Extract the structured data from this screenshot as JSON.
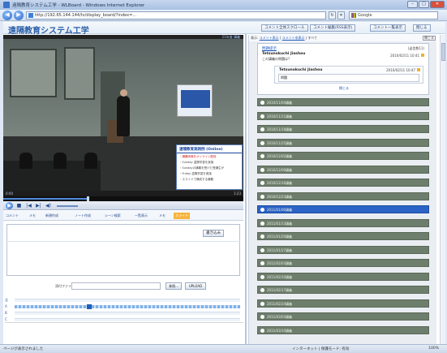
{
  "browser": {
    "window_title": "遠隔教育システム工学 - WLBoard - Windows Internet Explorer",
    "url": "http://192.65.144.144/tv/display_board/?index=…",
    "search_placeholder": "Google",
    "nav_back": "◀",
    "nav_forward": "▶",
    "refresh": "↻",
    "stop": "✕",
    "status_left": "ページが表示されました",
    "status_zone": "インターネット | 保護モード: 有効",
    "status_zoom": "100%"
  },
  "app": {
    "title": "遠隔教育システム工学",
    "buttons": [
      "コメント全体スクロール",
      "コメント編集(RSS表示)",
      "コメント一覧表示",
      "閉じる"
    ]
  },
  "player": {
    "top_label": "21年度 講義",
    "time_current": "0:00",
    "time_total": "1:23",
    "progress_fraction": 0.35,
    "controls": [
      "▶",
      "■",
      "|◀",
      "▶|",
      "◀)"
    ],
    "toolbar_items": [
      "コメント",
      "メモ",
      "新規作成",
      "ノート作成",
      "シーン検索",
      "一覧表示",
      "メモ",
      "スライド"
    ],
    "slide": {
      "title": "遠隔教育実践例 (Online)",
      "lines": [
        "・講義映像をオンライン配信",
        "・Sunday 遠隔学習を実施",
        "・Sundayの講義を受けた受講生が",
        "・Friday 遠隔学習を実施",
        "・スライドで構成する講義"
      ]
    }
  },
  "editor": {
    "post_label": "書き込み",
    "file_label": "添付ファイル",
    "browse_label": "参照...",
    "upload_label": "UPLOAD"
  },
  "comments": {
    "header_prefix": "表示:",
    "links": [
      "コメント表示",
      "コメント非表示"
    ],
    "header_suffix": "| すべて",
    "close_btn": "閉じる",
    "thread_title": "問題提示",
    "thread_count": "(返信数11)",
    "author": "Tetsunokuchi Jiashou",
    "body": "この講義の問題は?",
    "date": "2010/02/11 10:41",
    "reply_author": "Tetsunokuchi Jiashou",
    "reply_date": "2010/02/11 10:47",
    "reply_body": "問題",
    "fold_link": "閉じる",
    "lectures": [
      "2010/11/04講義",
      "2010/11/11講義",
      "2010/11/18講義",
      "2010/11/25講義",
      "2010/12/02講義",
      "2010/12/09講義",
      "2010/12/16講義",
      "2010/12/23講義",
      "2011/01/06講義",
      "2011/01/13講義",
      "2011/01/20講義",
      "2011/01/27講義",
      "2011/02/03講義",
      "2011/02/10講義",
      "2011/02/17講義",
      "2011/02/24講義",
      "2011/03/03講義",
      "2011/03/10講義"
    ],
    "active_index": 8
  },
  "timeline": {
    "rows": [
      "全",
      "A",
      "B",
      "C"
    ],
    "marker_fraction": 0.32
  },
  "colors": {
    "accent": "#2c63c6",
    "lecture_row": "#6e7e6c",
    "brand_title": "#2b5fa8",
    "highlight_tab": "#f7b33b"
  }
}
